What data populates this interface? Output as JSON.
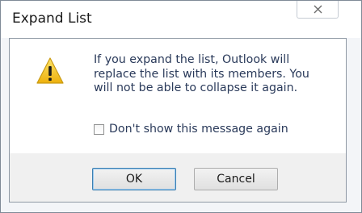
{
  "dialog": {
    "title": "Expand List",
    "close_icon": "close-icon",
    "warning_icon": "warning-icon",
    "message": "If you expand the list, Outlook will\nreplace the list with its members. You\nwill not be able to collapse it again.",
    "checkbox": {
      "label": "Don't show this message again",
      "checked": false
    },
    "buttons": {
      "ok_label": "OK",
      "cancel_label": "Cancel"
    }
  },
  "colors": {
    "title_text": "#1a1a1a",
    "message_text": "#2a3a5a",
    "warning_fill": "#f2c21b",
    "ok_border": "#3c7fb1"
  }
}
